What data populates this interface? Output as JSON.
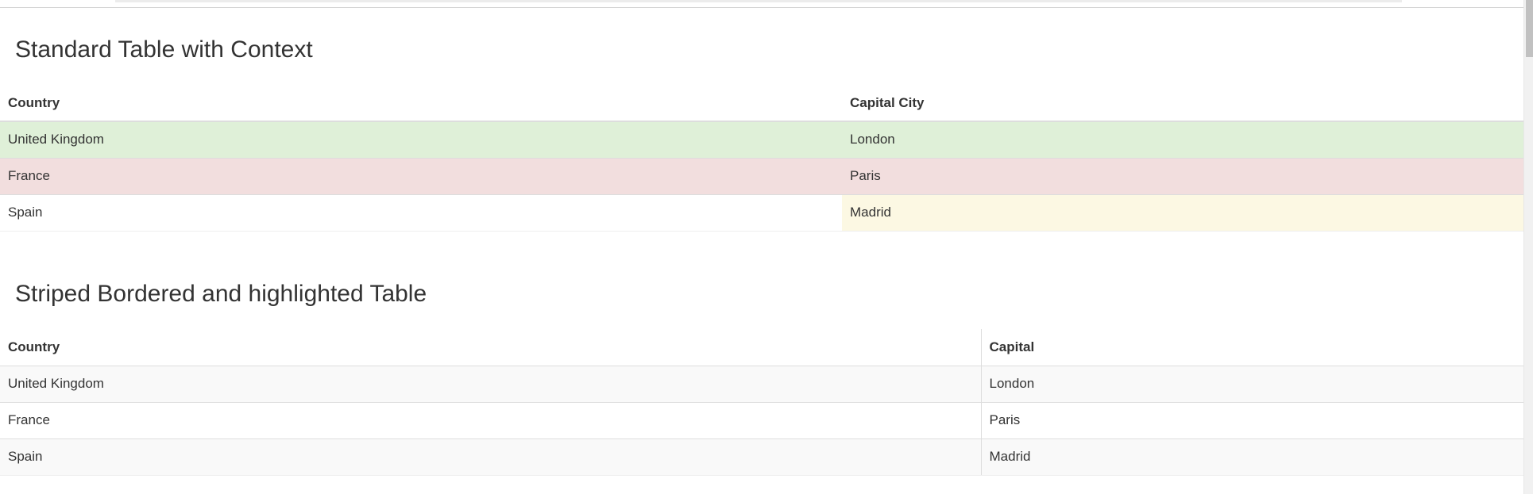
{
  "colors": {
    "success_row": "#dff0d8",
    "danger_row": "#f2dede",
    "warning_cell": "#fcf8e3",
    "stripe_row": "#f9f9f9"
  },
  "table_context": {
    "title": "Standard Table with Context",
    "headers": [
      "Country",
      "Capital City"
    ],
    "rows": [
      {
        "country": "United Kingdom",
        "capital": "London",
        "context": "success"
      },
      {
        "country": "France",
        "capital": "Paris",
        "context": "danger"
      },
      {
        "country": "Spain",
        "capital": "Madrid",
        "context": "warning-on-capital-cell"
      }
    ]
  },
  "table_striped": {
    "title": "Striped Bordered and highlighted Table",
    "headers": [
      "Country",
      "Capital"
    ],
    "rows": [
      {
        "country": "United Kingdom",
        "capital": "London"
      },
      {
        "country": "France",
        "capital": "Paris"
      },
      {
        "country": "Spain",
        "capital": "Madrid"
      }
    ]
  }
}
